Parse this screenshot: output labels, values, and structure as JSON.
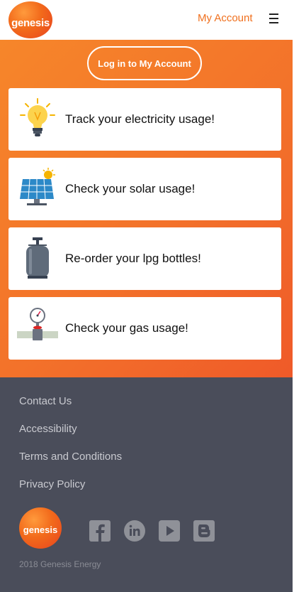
{
  "header": {
    "logo_text": "genesis",
    "account_link": "My Account",
    "menu_icon": "hamburger-menu-icon"
  },
  "hero": {
    "login_button": "Log in to My Account",
    "cards": [
      {
        "label": "Track your electricity usage!",
        "icon": "lightbulb-icon"
      },
      {
        "label": "Check your solar usage!",
        "icon": "solar-panel-icon"
      },
      {
        "label": "Re-order your lpg bottles!",
        "icon": "gas-bottle-icon"
      },
      {
        "label": "Check your gas usage!",
        "icon": "gas-meter-icon"
      }
    ]
  },
  "footer": {
    "links": [
      "Contact Us",
      "Accessibility",
      "Terms and Conditions",
      "Privacy Policy"
    ],
    "logo_text": "genesis",
    "social": [
      "facebook-icon",
      "linkedin-icon",
      "youtube-icon",
      "blogger-icon"
    ],
    "copyright": "2018 Genesis Energy"
  },
  "colors": {
    "brand_orange": "#f3722a",
    "accent_text": "#f0701e",
    "footer_bg": "#4a4d5a",
    "social_icon": "#8f9198"
  }
}
